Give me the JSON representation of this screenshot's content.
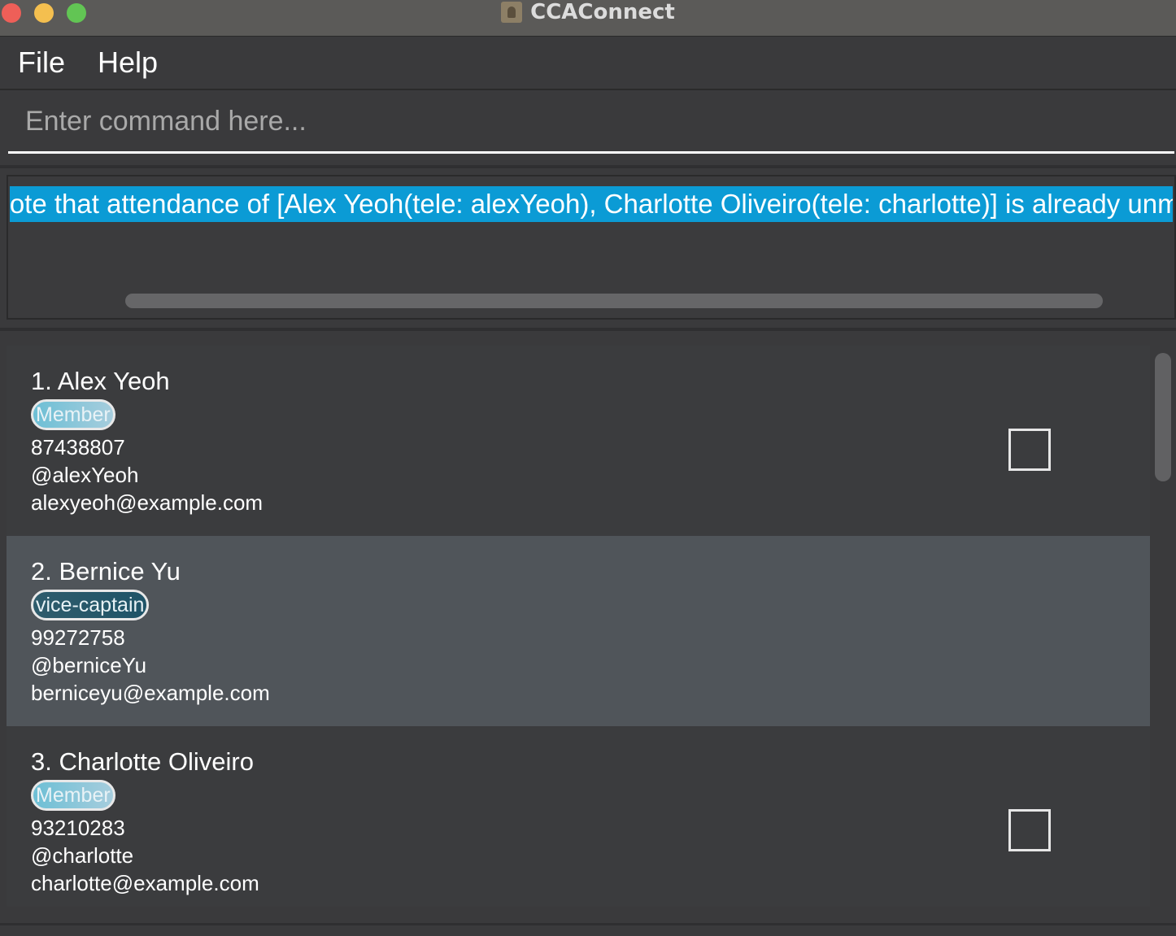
{
  "window": {
    "title": "CCAConnect",
    "app_icon": "contacts-book-icon"
  },
  "menu": {
    "items": [
      "File",
      "Help"
    ]
  },
  "command": {
    "placeholder": "Enter command here...",
    "value": ""
  },
  "result": {
    "text": "Note that attendance of [Alex Yeoh(tele: alexYeoh), Charlotte Oliveiro(tele: charlotte)] is already unmarked."
  },
  "persons": [
    {
      "name": "1. Alex Yeoh",
      "role": "Member",
      "phone": "87438807",
      "telegram": "@alexYeoh",
      "email": "alexyeoh@example.com",
      "has_checkbox": true,
      "checked": false
    },
    {
      "name": "2. Bernice Yu",
      "role": "vice-captain",
      "phone": "99272758",
      "telegram": "@berniceYu",
      "email": "berniceyu@example.com",
      "has_checkbox": false,
      "selected": true
    },
    {
      "name": "3. Charlotte Oliveiro",
      "role": "Member",
      "phone": "93210283",
      "telegram": "@charlotte",
      "email": "charlotte@example.com",
      "has_checkbox": true,
      "checked": false
    }
  ],
  "colors": {
    "background": "#3a3a3c",
    "result_highlight": "#0b9bd5",
    "selected_card": "#50555a",
    "member_tag": "#6dbfd5",
    "vice_captain_tag": "#2f5c6c"
  }
}
